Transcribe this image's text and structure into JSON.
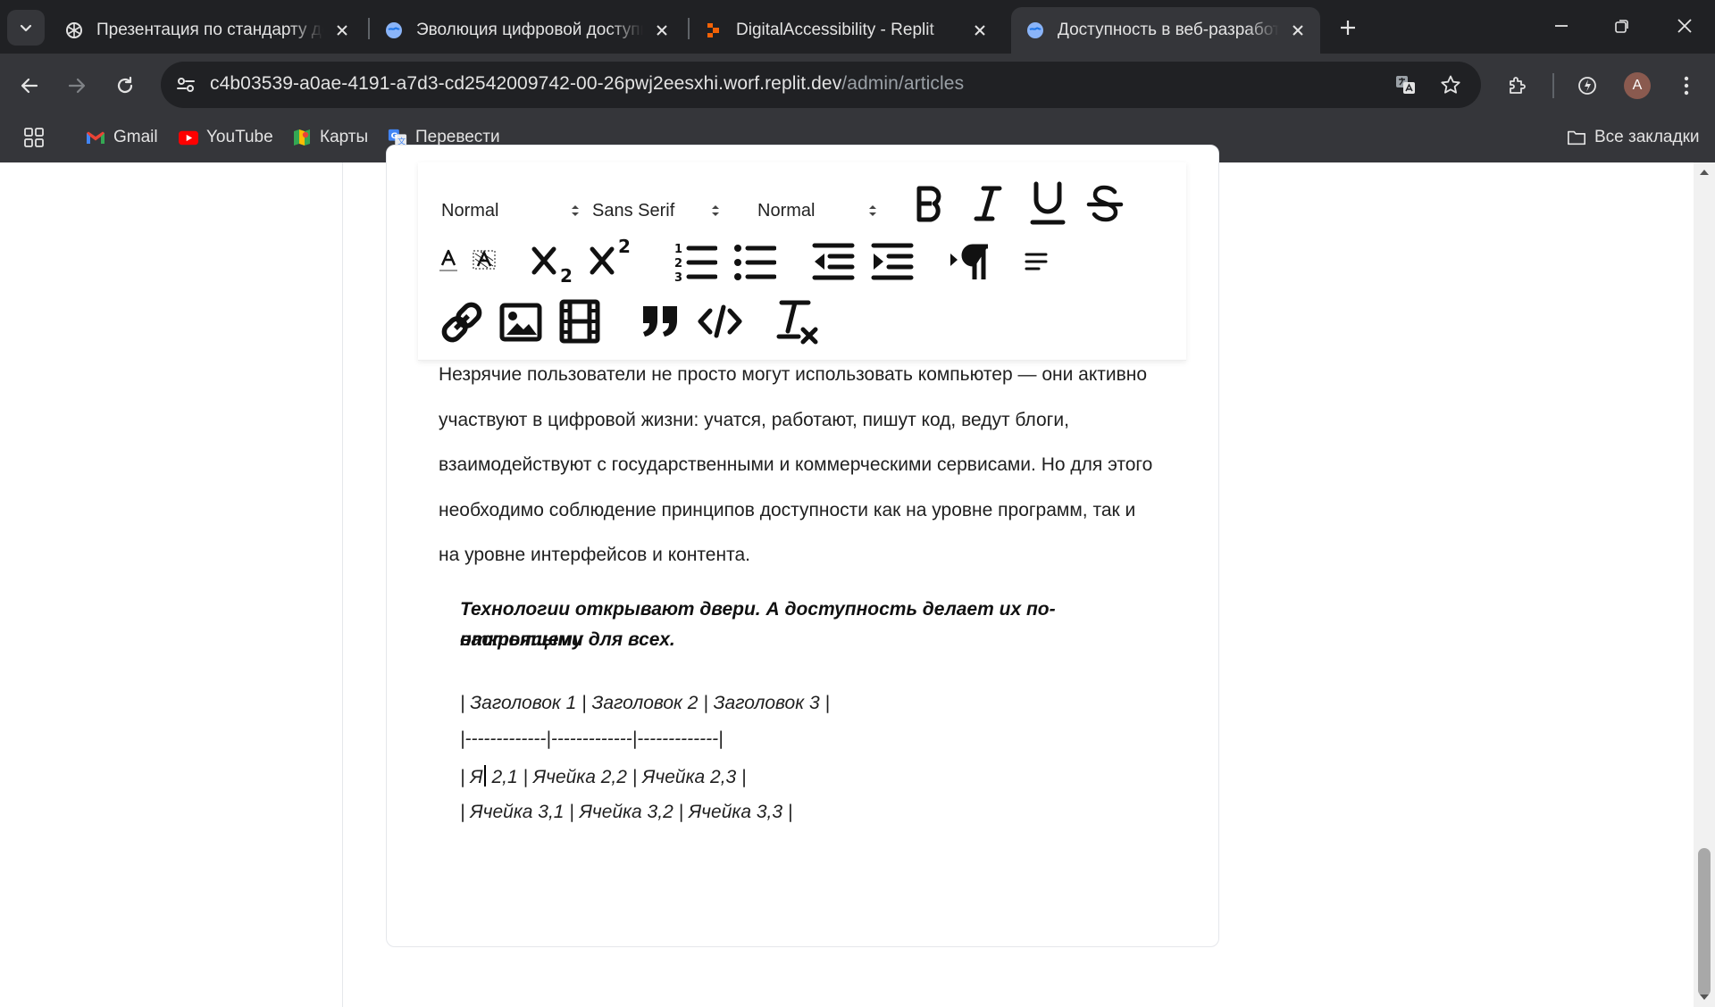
{
  "browser": {
    "tabs": [
      {
        "title": "Презентация по стандарту до",
        "favicon": "chatgpt-icon",
        "active": false
      },
      {
        "title": "Эволюция цифровой доступн",
        "favicon": "replit-globe-icon",
        "active": false
      },
      {
        "title": "DigitalAccessibility - Replit",
        "favicon": "replit-icon",
        "active": false
      },
      {
        "title": "Доступность в веб-разработк",
        "favicon": "replit-globe-icon",
        "active": true
      }
    ],
    "url_host": "c4b03539-a0ae-4191-a7d3-cd2542009742-00-26pwj2eesxhi.worf.replit.dev",
    "url_path": "/admin/articles",
    "avatar_letter": "A",
    "bookmarks": [
      {
        "label": "Gmail",
        "icon": "gmail-icon"
      },
      {
        "label": "YouTube",
        "icon": "youtube-icon"
      },
      {
        "label": "Карты",
        "icon": "maps-icon"
      },
      {
        "label": "Перевести",
        "icon": "translate-icon"
      }
    ],
    "all_bookmarks": "Все закладки"
  },
  "editor_toolbar": {
    "header_picker": "Normal",
    "font_picker": "Sans Serif",
    "size_picker": "Normal",
    "buttons": [
      "bold",
      "italic",
      "underline",
      "strike",
      "color",
      "background",
      "subscript",
      "superscript",
      "ordered-list",
      "bullet-list",
      "outdent",
      "indent",
      "direction",
      "align",
      "link",
      "image",
      "video",
      "blockquote",
      "code-block",
      "clean"
    ]
  },
  "content": {
    "paragraph_lines": [
      "Незрячие пользователи не просто могут использовать компьютер — они активно",
      "участвуют в цифровой жизни: учатся, работают, пишут код, ведут блоги,",
      "взаимодействуют с государственными и коммерческими сервисами. Но для этого",
      "необходимо соблюдение принципов доступности как на уровне программ, так и",
      "на уровне интерфейсов и контента."
    ],
    "quote_lines": [
      "Технологии открывают двери. А доступность делает их по-настоящему",
      "открытыми для всех."
    ],
    "table_lines": [
      "| Заголовок 1 | Заголовок 2 | Заголовок 3 |",
      "|-------------|-------------|-------------|",
      "| Ячейка 3,1 | Ячейка 3,2 | Ячейка 3,3 |"
    ],
    "cursor_line_before": "| Я",
    "cursor_line_after": " 2,1 | Ячейка 2,2 | Ячейка 2,3 |"
  }
}
